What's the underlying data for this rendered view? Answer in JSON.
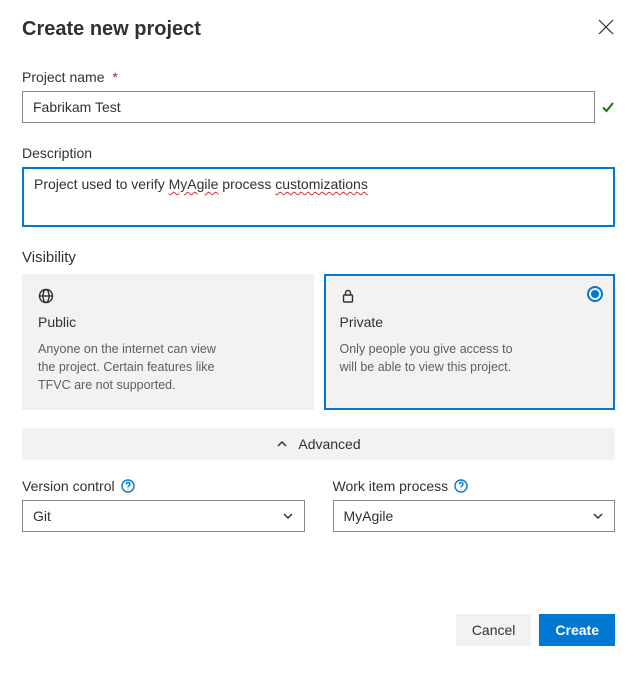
{
  "dialog": {
    "title": "Create new project"
  },
  "fields": {
    "projectName": {
      "label": "Project name",
      "value": "Fabrikam Test",
      "required": "*"
    },
    "description": {
      "label": "Description",
      "value_parts": {
        "pre": "Project used to verify ",
        "w1": "MyAgile",
        "mid": " process ",
        "w2": "customizations"
      }
    }
  },
  "visibility": {
    "label": "Visibility",
    "options": [
      {
        "key": "public",
        "title": "Public",
        "desc": "Anyone on the internet can view the project. Certain features like TFVC are not supported.",
        "selected": false
      },
      {
        "key": "private",
        "title": "Private",
        "desc": "Only people you give access to will be able to view this project.",
        "selected": true
      }
    ]
  },
  "advanced": {
    "toggle_label": "Advanced",
    "version_control": {
      "label": "Version control",
      "value": "Git"
    },
    "work_item_process": {
      "label": "Work item process",
      "value": "MyAgile"
    }
  },
  "buttons": {
    "cancel": "Cancel",
    "create": "Create"
  }
}
